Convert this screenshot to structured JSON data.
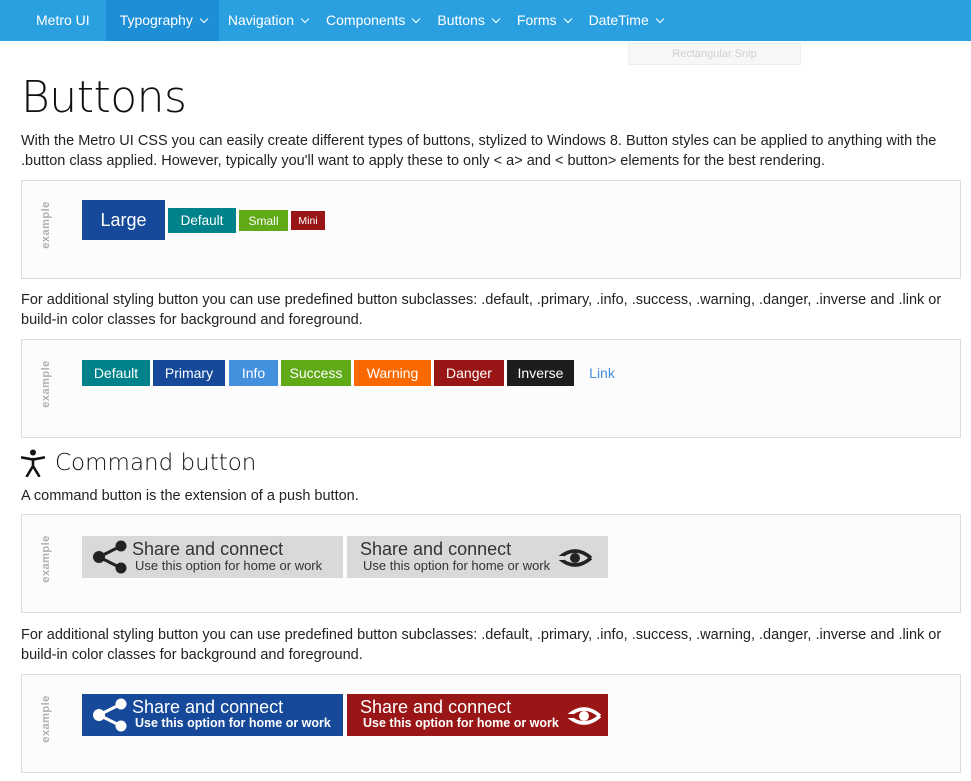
{
  "navbar": {
    "brand": "Metro UI",
    "items": [
      {
        "label": "Typography",
        "active": true
      },
      {
        "label": "Navigation"
      },
      {
        "label": "Components"
      },
      {
        "label": "Buttons"
      },
      {
        "label": "Forms"
      },
      {
        "label": "DateTime"
      }
    ]
  },
  "overlay": {
    "snip_label": "Rectangular Snip"
  },
  "page": {
    "title": "Buttons",
    "intro": "With the Metro UI CSS you can easily create different types of buttons, stylized to Windows 8. Button styles can be applied to anything with the .button class applied. However, typically you'll want to apply these to only < a> and < button> elements for the best rendering.",
    "subclasses_text": "For additional styling button you can use predefined button subclasses: .default, .primary, .info, .success, .warning, .danger, .inverse and .link or build-in color classes for background and foreground.",
    "example_label": "example"
  },
  "size_buttons": {
    "large": "Large",
    "default": "Default",
    "small": "Small",
    "mini": "Mini"
  },
  "style_buttons": {
    "default": "Default",
    "primary": "Primary",
    "info": "Info",
    "success": "Success",
    "warning": "Warning",
    "danger": "Danger",
    "inverse": "Inverse",
    "link": "Link"
  },
  "command_section": {
    "title": "Command button",
    "description": "A command button is the extension of a push button.",
    "subclasses_text": "For additional styling button you can use predefined button subclasses: .default, .primary, .info, .success, .warning, .danger, .inverse and .link or build-in color classes for background and foreground."
  },
  "command_buttons": {
    "main": "Share and connect",
    "sub": "Use this option for home or work"
  },
  "colors": {
    "nav": "#2aa0e0",
    "primary": "#16499a",
    "teal": "#00828a",
    "info": "#4390df",
    "success": "#60a917",
    "warning": "#fa6800",
    "danger": "#9a1616",
    "inverse": "#1d1d1d",
    "command_gray": "#d9d9d9"
  }
}
